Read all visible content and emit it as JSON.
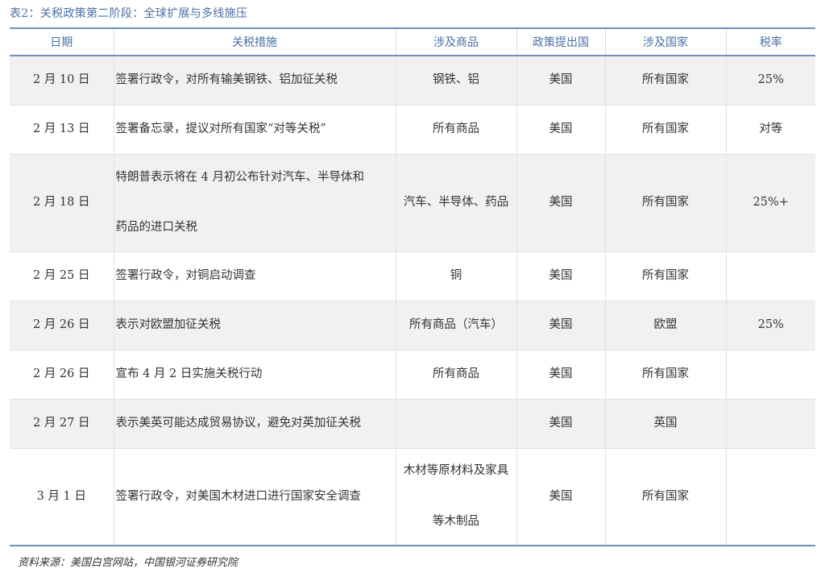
{
  "caption": "表2：关税政策第二阶段：全球扩展与多线施压",
  "headers": [
    "日期",
    "关税措施",
    "涉及商品",
    "政策提出国",
    "涉及国家",
    "税率"
  ],
  "rows": [
    {
      "date": "2 月 10 日",
      "measure": "签署行政令，对所有输美钢铁、铝加征关税",
      "goods": "钢铁、铝",
      "proposer": "美国",
      "countries": "所有国家",
      "rate": "25%"
    },
    {
      "date": "2 月 13 日",
      "measure": "签署备忘录，提议对所有国家“对等关税”",
      "goods": "所有商品",
      "proposer": "美国",
      "countries": "所有国家",
      "rate": "对等"
    },
    {
      "date": "2 月 18 日",
      "measure_line1": "特朗普表示将在 4 月初公布针对汽车、半导体和",
      "measure_line2": "药品的进口关税",
      "goods": "汽车、半导体、药品",
      "proposer": "美国",
      "countries": "所有国家",
      "rate": "25%+"
    },
    {
      "date": "2 月 25 日",
      "measure": "签署行政令，对铜启动调查",
      "goods": "铜",
      "proposer": "美国",
      "countries": "所有国家",
      "rate": ""
    },
    {
      "date": "2 月 26 日",
      "measure": "表示对欧盟加征关税",
      "goods": "所有商品（汽车）",
      "proposer": "美国",
      "countries": "欧盟",
      "rate": "25%"
    },
    {
      "date": "2 月 26 日",
      "measure": "宣布 4 月 2 日实施关税行动",
      "goods": "所有商品",
      "proposer": "美国",
      "countries": "所有国家",
      "rate": ""
    },
    {
      "date": "2 月 27 日",
      "measure": "表示美英可能达成贸易协议，避免对英加征关税",
      "goods": "",
      "proposer": "美国",
      "countries": "英国",
      "rate": ""
    },
    {
      "date": "3 月 1 日",
      "measure": "签署行政令，对美国木材进口进行国家安全调查",
      "goods_line1": "木材等原材料及家具",
      "goods_line2": "等木制品",
      "proposer": "美国",
      "countries": "所有国家",
      "rate": ""
    }
  ],
  "source": "资料来源：美国白宫网站，中国银河证券研究院"
}
